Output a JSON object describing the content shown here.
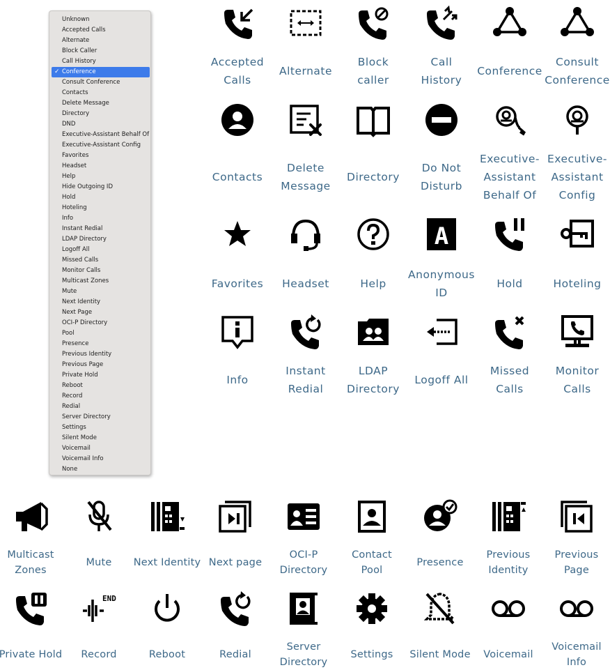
{
  "menu": {
    "selected_index": 5,
    "checkmark": "✓",
    "items": [
      "Unknown",
      "Accepted Calls",
      "Alternate",
      "Block Caller",
      "Call History",
      "Conference",
      "Consult Conference",
      "Contacts",
      "Delete Message",
      "Directory",
      "DND",
      "Executive-Assistant Behalf Of",
      "Executive-Assistant Config",
      "Favorites",
      "Headset",
      "Help",
      "Hide Outgoing ID",
      "Hold",
      "Hoteling",
      "Info",
      "Instant Redial",
      "LDAP Directory",
      "Logoff All",
      "Missed Calls",
      "Monitor Calls",
      "Multicast Zones",
      "Mute",
      "Next Identity",
      "Next Page",
      "OCI-P Directory",
      "Pool",
      "Presence",
      "Previous Identity",
      "Previous Page",
      "Private Hold",
      "Reboot",
      "Record",
      "Redial",
      "Server Directory",
      "Settings",
      "Silent Mode",
      "Voicemail",
      "Voicemail Info",
      "None"
    ]
  },
  "top_grid": [
    [
      {
        "label": [
          "Accepted",
          "Calls"
        ],
        "icon": "accepted-calls-icon"
      },
      {
        "label": [
          "Alternate"
        ],
        "icon": "alternate-icon"
      },
      {
        "label": [
          "Block",
          "caller"
        ],
        "icon": "block-caller-icon"
      },
      {
        "label": [
          "Call",
          "History"
        ],
        "icon": "call-history-icon"
      },
      {
        "label": [
          "Conference"
        ],
        "icon": "conference-icon"
      },
      {
        "label": [
          "Consult",
          "Conference"
        ],
        "icon": "consult-conference-icon"
      }
    ],
    [
      {
        "label": [
          "Contacts"
        ],
        "icon": "contacts-icon"
      },
      {
        "label": [
          "Delete",
          "Message"
        ],
        "icon": "delete-message-icon"
      },
      {
        "label": [
          "Directory"
        ],
        "icon": "directory-icon"
      },
      {
        "label": [
          "Do Not",
          "Disturb"
        ],
        "icon": "do-not-disturb-icon"
      },
      {
        "label": [
          "Executive-",
          "Assistant",
          "Behalf Of"
        ],
        "icon": "executive-assistant-behalf-of-icon"
      },
      {
        "label": [
          "Executive-",
          "Assistant",
          "Config"
        ],
        "icon": "executive-assistant-config-icon"
      }
    ],
    [
      {
        "label": [
          "Favorites"
        ],
        "icon": "favorites-icon"
      },
      {
        "label": [
          "Headset"
        ],
        "icon": "headset-icon"
      },
      {
        "label": [
          "Help"
        ],
        "icon": "help-icon"
      },
      {
        "label": [
          "Anonymous",
          "ID"
        ],
        "icon": "anonymous-id-icon"
      },
      {
        "label": [
          "Hold"
        ],
        "icon": "hold-icon"
      },
      {
        "label": [
          "Hoteling"
        ],
        "icon": "hoteling-icon"
      }
    ],
    [
      {
        "label": [
          "Info"
        ],
        "icon": "info-icon"
      },
      {
        "label": [
          "Instant",
          "Redial"
        ],
        "icon": "instant-redial-icon"
      },
      {
        "label": [
          "LDAP",
          "Directory"
        ],
        "icon": "ldap-directory-icon"
      },
      {
        "label": [
          "Logoff All"
        ],
        "icon": "logoff-all-icon"
      },
      {
        "label": [
          "Missed",
          "Calls"
        ],
        "icon": "missed-calls-icon"
      },
      {
        "label": [
          "Monitor",
          "Calls"
        ],
        "icon": "monitor-calls-icon"
      }
    ]
  ],
  "bottom_grid": [
    [
      {
        "label": [
          "Multicast",
          "Zones"
        ],
        "icon": "multicast-zones-icon"
      },
      {
        "label": [
          "Mute"
        ],
        "icon": "mute-icon"
      },
      {
        "label": [
          "Next Identity"
        ],
        "icon": "next-identity-icon"
      },
      {
        "label": [
          "Next page"
        ],
        "icon": "next-page-icon"
      },
      {
        "label": [
          "OCI-P",
          "Directory"
        ],
        "icon": "ocip-directory-icon"
      },
      {
        "label": [
          "Contact",
          "Pool"
        ],
        "icon": "contact-pool-icon"
      },
      {
        "label": [
          "Presence"
        ],
        "icon": "presence-icon"
      },
      {
        "label": [
          "Previous",
          "Identity"
        ],
        "icon": "previous-identity-icon"
      },
      {
        "label": [
          "Previous",
          "Page"
        ],
        "icon": "previous-page-icon"
      }
    ],
    [
      {
        "label": [
          "Private Hold"
        ],
        "icon": "private-hold-icon"
      },
      {
        "label": [
          "Record"
        ],
        "icon": "record-icon",
        "icon_text": "END"
      },
      {
        "label": [
          "Reboot"
        ],
        "icon": "reboot-icon"
      },
      {
        "label": [
          "Redial"
        ],
        "icon": "redial-icon"
      },
      {
        "label": [
          "Server",
          "Directory"
        ],
        "icon": "server-directory-icon"
      },
      {
        "label": [
          "Settings"
        ],
        "icon": "settings-icon"
      },
      {
        "label": [
          "Silent Mode"
        ],
        "icon": "silent-mode-icon"
      },
      {
        "label": [
          "Voicemail"
        ],
        "icon": "voicemail-icon"
      },
      {
        "label": [
          "Voicemail",
          "Info"
        ],
        "icon": "voicemail-info-icon"
      }
    ]
  ]
}
